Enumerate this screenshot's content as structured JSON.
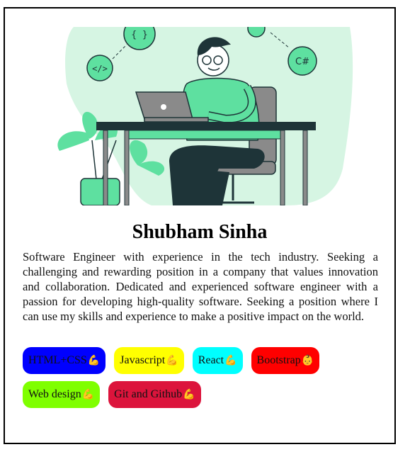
{
  "profile": {
    "name": "Shubham Sinha",
    "bio": "Software Engineer with experience in the tech industry. Seeking a challenging and rewarding position in a company that values innovation and collaboration. Dedicated and experienced software engineer with a passion for developing high-quality software. Seeking a position where I can use my skills and experience to make a positive impact on the world."
  },
  "illustration": {
    "icon_code": "</>",
    "icon_braces": "{ }",
    "icon_csharp": "C#"
  },
  "skills": [
    {
      "label": "HTML+CSS",
      "emoji": "💪",
      "color": "#0000ff"
    },
    {
      "label": "Javascript",
      "emoji": "💪",
      "color": "#ffff00"
    },
    {
      "label": "React",
      "emoji": "💪",
      "color": "#00ffff"
    },
    {
      "label": "Bootstrap",
      "emoji": "👶",
      "color": "#ff0000"
    },
    {
      "label": "Web design",
      "emoji": "💪",
      "color": "#7fff00"
    },
    {
      "label": "Git and Github",
      "emoji": "💪",
      "color": "#dc143c"
    }
  ]
}
